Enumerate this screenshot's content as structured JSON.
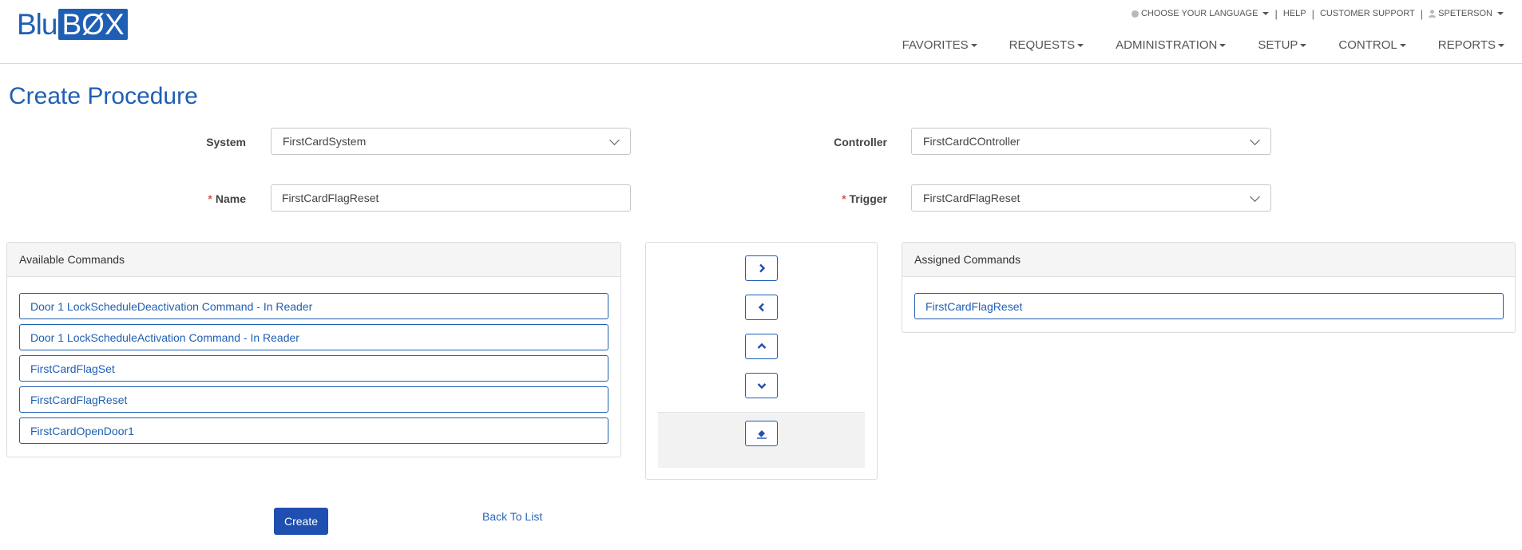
{
  "logo": {
    "part1": "Blu",
    "part2": "BØX"
  },
  "util": {
    "language": "CHOOSE YOUR LANGUAGE",
    "help": "HELP",
    "support": "CUSTOMER SUPPORT",
    "user": "SPETERSON"
  },
  "nav": {
    "favorites": "FAVORITES",
    "requests": "REQUESTS",
    "administration": "ADMINISTRATION",
    "setup": "SETUP",
    "control": "CONTROL",
    "reports": "REPORTS"
  },
  "page": {
    "title": "Create Procedure"
  },
  "form": {
    "system_label": "System",
    "system_value": "FirstCardSystem",
    "controller_label": "Controller",
    "controller_value": "FirstCardCOntroller",
    "name_label": "Name",
    "name_value": "FirstCardFlagReset",
    "trigger_label": "Trigger",
    "trigger_value": "FirstCardFlagReset",
    "required_mark": "*"
  },
  "available": {
    "title": "Available Commands",
    "items": [
      "Door 1 LockScheduleDeactivation Command - In Reader",
      "Door 1 LockScheduleActivation Command - In Reader",
      "FirstCardFlagSet",
      "FirstCardFlagReset",
      "FirstCardOpenDoor1"
    ]
  },
  "assigned": {
    "title": "Assigned Commands",
    "items": [
      "FirstCardFlagReset"
    ]
  },
  "actions": {
    "create": "Create",
    "back": "Back To List"
  },
  "colors": {
    "brand": "#1f5fb3",
    "required": "#d9534f"
  }
}
